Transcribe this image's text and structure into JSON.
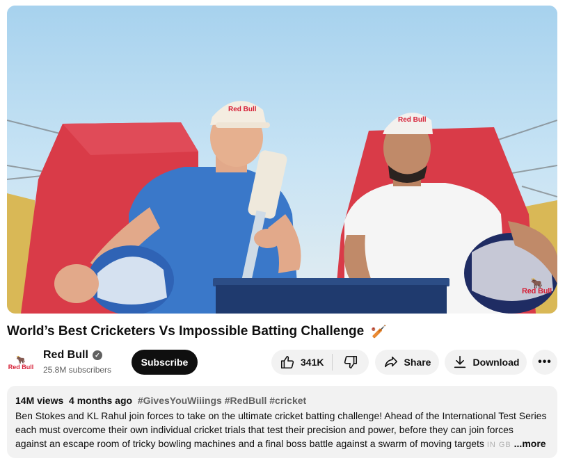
{
  "video": {
    "title": "World’s Best Cricketers Vs Impossible Batting Challenge",
    "title_emoji": "🏏",
    "watermark": "Red Bull",
    "cap_text": "Red Bull"
  },
  "channel": {
    "logo_text": "Red Bull",
    "name": "Red Bull",
    "verified_icon": "checkmark-circle-icon",
    "subscribers": "25.8M subscribers",
    "subscribe_label": "Subscribe"
  },
  "actions": {
    "like_count": "341K",
    "share_label": "Share",
    "download_label": "Download",
    "more_label": "•••"
  },
  "description": {
    "views": "14M views",
    "age": "4 months ago",
    "hashtags": "#GivesYouWiiings #RedBull #cricket",
    "lines": [
      "Ben Stokes and KL Rahul join forces to take on the ultimate cricket batting challenge! Ahead of the International Test Series",
      "each must overcome their own individual cricket trials that test their precision and power, before they can join forces",
      "against an escape room of tricky bowling machines and a final boss battle against a swarm of moving targets"
    ],
    "faded_tail": "IN GB",
    "more_link": "...more"
  },
  "colors": {
    "brand_red": "#d51e35",
    "button_bg": "#f2f2f2",
    "subscribe_bg": "#0f0f0f",
    "secondary_text": "#606060"
  }
}
